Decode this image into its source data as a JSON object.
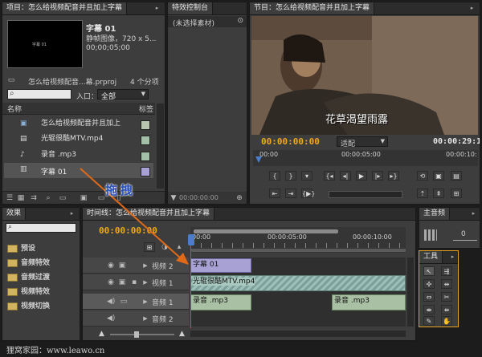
{
  "project": {
    "tab": "项目：怎么给视频配音并且加上字幕",
    "clip_name": "字幕 01",
    "clip_info": "静帧图像，720 x 5...",
    "clip_duration": "00;00;05;00",
    "thumb_text": "字幕 01",
    "file_name": "怎么给视频配音...幕.prproj",
    "item_count": "4 个分项",
    "search_placeholder": "",
    "inlet_label": "入口：",
    "inlet_value": "全部",
    "col_name": "名称",
    "col_label": "标签",
    "items": [
      {
        "name": "怎么给视频配音并且加上",
        "icon": "sequence-icon",
        "color": "#b8c4b0"
      },
      {
        "name": "光辊很酷MTV.mp4",
        "icon": "video-file-icon",
        "color": "#a5c0a8"
      },
      {
        "name": "录音 .mp3",
        "icon": "audio-file-icon",
        "color": "#a5c0a8"
      },
      {
        "name": "字幕 01",
        "icon": "title-icon",
        "color": "#a8a2d4"
      }
    ]
  },
  "effect_controls": {
    "tab": "特效控制台",
    "no_clip": "(未选择素材)",
    "time": "00:00:00:00"
  },
  "program": {
    "tab": "节目：怎么给视频配音并且加上字幕",
    "subtitle": "花草渴望雨露",
    "current_time": "00:00:00:00",
    "fit": "适配",
    "duration": "00:00:29:13",
    "ruler": [
      "00:00",
      "00:00:05:00",
      "00:00:10:"
    ]
  },
  "effects": {
    "tab": "效果",
    "folders": [
      "预设",
      "音频特效",
      "音频过渡",
      "视频特效",
      "视频切换"
    ]
  },
  "timeline": {
    "tab": "时间线：怎么给视频配音并且加上字幕",
    "current_time": "00:00:00:00",
    "ruler": [
      "00:00",
      "00:00:05:00",
      "00:00:10:00"
    ],
    "tracks": [
      {
        "name": "视频 2"
      },
      {
        "name": "视频 1"
      },
      {
        "name": "音频 1"
      },
      {
        "name": "音频 2"
      }
    ],
    "clips": {
      "title_clip": "字幕 01",
      "video_clip": "光辊很酷MTV.mp4",
      "audio_clip_a": "录音 .mp3",
      "audio_clip_b": "录音 .mp3"
    }
  },
  "audio_master": {
    "tab": "主音频",
    "level": "0"
  },
  "tools": {
    "tab": "工具"
  },
  "annotation": {
    "drag_label": "拖拽",
    "arrow_color": "#e06a18",
    "label_color": "#2a4fb8"
  },
  "watermark": "狸窝家园：www.leawo.cn"
}
